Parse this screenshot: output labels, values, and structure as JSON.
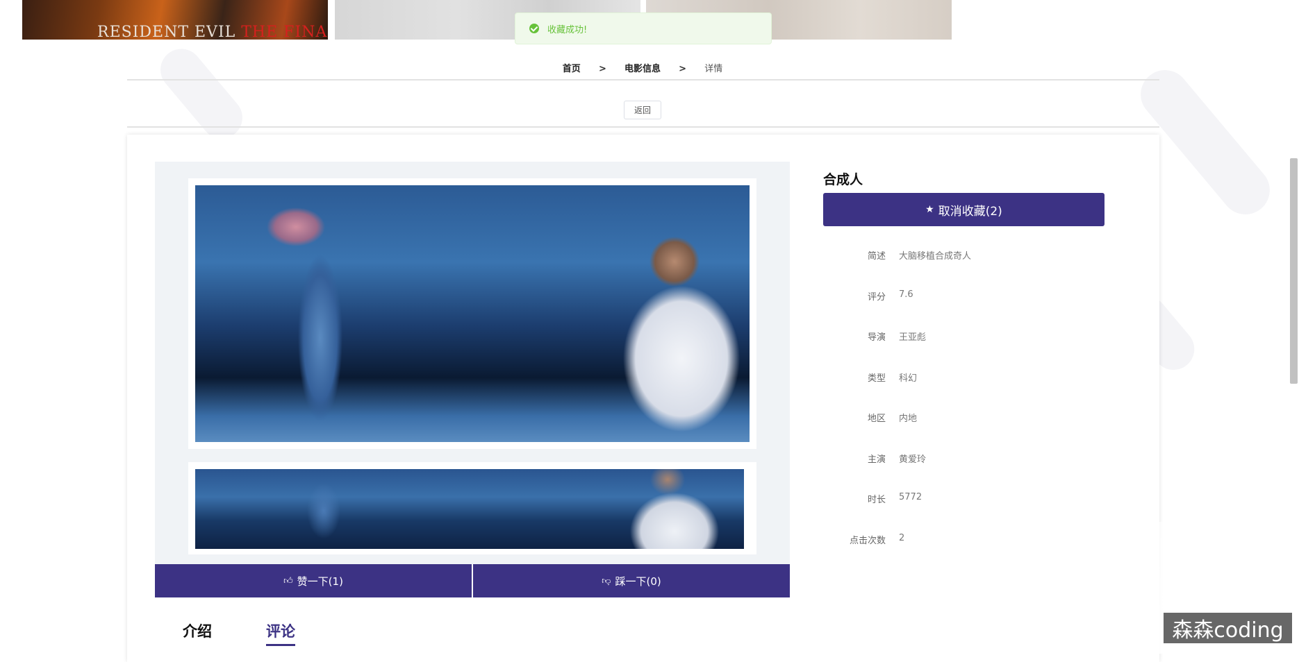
{
  "toast": {
    "message": "收藏成功!"
  },
  "banner": {
    "title_part1": "RESIDENT EVIL",
    "title_part2": "THE FINAL CHAPTER"
  },
  "breadcrumb": {
    "home": "首页",
    "sep": ">",
    "section": "电影信息",
    "current": "详情"
  },
  "back_label": "返回",
  "movie": {
    "title": "合成人",
    "favorite_label": "取消收藏(2)",
    "like_label": "赞一下(1)",
    "dislike_label": "踩一下(0)",
    "info": [
      {
        "key": "简述",
        "value": "大脑移植合成奇人"
      },
      {
        "key": "评分",
        "value": "7.6"
      },
      {
        "key": "导演",
        "value": "王亚彪"
      },
      {
        "key": "类型",
        "value": "科幻"
      },
      {
        "key": "地区",
        "value": "内地"
      },
      {
        "key": "主演",
        "value": "黄爱玲"
      },
      {
        "key": "时长",
        "value": "5772"
      },
      {
        "key": "点击次数",
        "value": "2"
      }
    ]
  },
  "tabs": [
    {
      "label": "介绍"
    },
    {
      "label": "评论"
    }
  ],
  "watermark": "森森coding",
  "colors": {
    "primary": "#3c3284",
    "success": "#67c23a"
  }
}
